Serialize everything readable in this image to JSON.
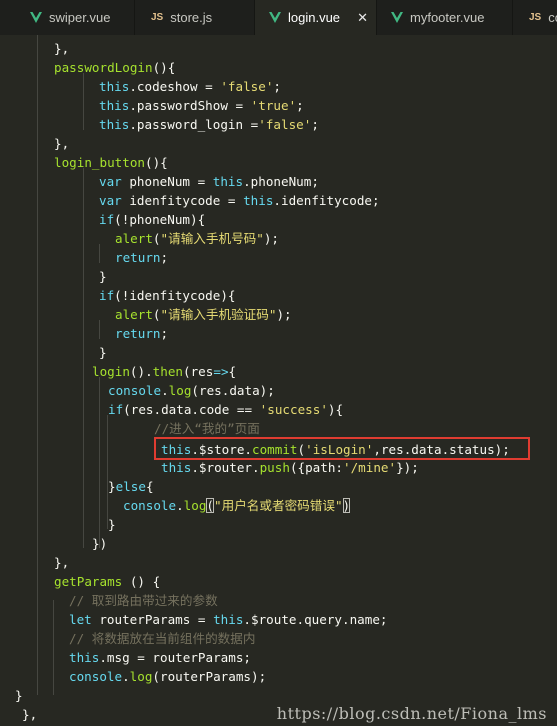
{
  "tabs": [
    {
      "label": "swiper.vue",
      "icon": "vue-icon",
      "active": false
    },
    {
      "label": "store.js",
      "icon": "js-icon",
      "active": false
    },
    {
      "label": "login.vue",
      "icon": "vue-icon",
      "active": true,
      "close": "✕"
    },
    {
      "label": "myfooter.vue",
      "icon": "vue-icon",
      "active": false
    },
    {
      "label": "co",
      "icon": "js-icon",
      "active": false
    }
  ],
  "icon_text": {
    "js": "JS"
  },
  "code": {
    "l01": "},",
    "l02a": "passwordLogin",
    "l02b": "(){",
    "l03a": "this",
    "l03b": ".codeshow = ",
    "l03c": "'false'",
    "l03d": ";",
    "l04a": "this",
    "l04b": ".passwordShow = ",
    "l04c": "'true'",
    "l04d": ";",
    "l05a": "this",
    "l05b": ".password_login =",
    "l05c": "'false'",
    "l05d": ";",
    "l06": "},",
    "l07a": "login_button",
    "l07b": "(){",
    "l08a": "var",
    "l08b": " phoneNum = ",
    "l08c": "this",
    "l08d": ".phoneNum;",
    "l09a": "var",
    "l09b": " idenfitycode = ",
    "l09c": "this",
    "l09d": ".idenfitycode;",
    "l10a": "if",
    "l10b": "(!phoneNum){",
    "l11a": "alert",
    "l11b": "(",
    "l11c": "\"请输入手机号码\"",
    "l11d": ");",
    "l12a": "return",
    "l12b": ";",
    "l13": "}",
    "l14a": "if",
    "l14b": "(!idenfitycode){",
    "l15a": "alert",
    "l15b": "(",
    "l15c": "\"请输入手机验证码\"",
    "l15d": ");",
    "l16a": "return",
    "l16b": ";",
    "l17": "}",
    "l18a": "login",
    "l18b": "().",
    "l18c": "then",
    "l18d": "(res",
    "l18e": "=>",
    "l18f": "{",
    "l19a": "console",
    "l19b": ".",
    "l19c": "log",
    "l19d": "(res.data);",
    "l20a": "if",
    "l20b": "(res.data.code == ",
    "l20c": "'success'",
    "l20d": "){",
    "l21": "//进入“我的”页面",
    "l22a": "this",
    "l22b": ".$store.",
    "l22c": "commit",
    "l22d": "(",
    "l22e": "'isLogin'",
    "l22f": ",res.data.status);",
    "l23a": "this",
    "l23b": ".$router.",
    "l23c": "push",
    "l23d": "({path:",
    "l23e": "'/mine'",
    "l23f": "});",
    "l24a": "}",
    "l24b": "else",
    "l24c": "{",
    "l25a": "console",
    "l25b": ".",
    "l25c": "log",
    "l25d": "(",
    "l25e": "\"用户名或者密码错误\"",
    "l25f": ")",
    "l26": "}",
    "l27": "})",
    "l28": "},",
    "l29a": "getParams",
    "l29b": " () {",
    "l30": "// 取到路由带过来的参数",
    "l31a": "let",
    "l31b": " routerParams = ",
    "l31c": "this",
    "l31d": ".$route.query.name;",
    "l32": "// 将数据放在当前组件的数据内",
    "l33a": "this",
    "l33b": ".msg = routerParams;",
    "l34a": "console",
    "l34b": ".",
    "l34c": "log",
    "l34d": "(routerParams);",
    "l35": "}",
    "l36": "},"
  },
  "watermark": "https://blog.csdn.net/Fiona_lms",
  "colors": {
    "background": "#272822",
    "keyword": "#66d9ef",
    "string": "#e6db74",
    "function": "#a6e22e",
    "comment": "#75715e",
    "highlight_box": "#e03c31"
  }
}
